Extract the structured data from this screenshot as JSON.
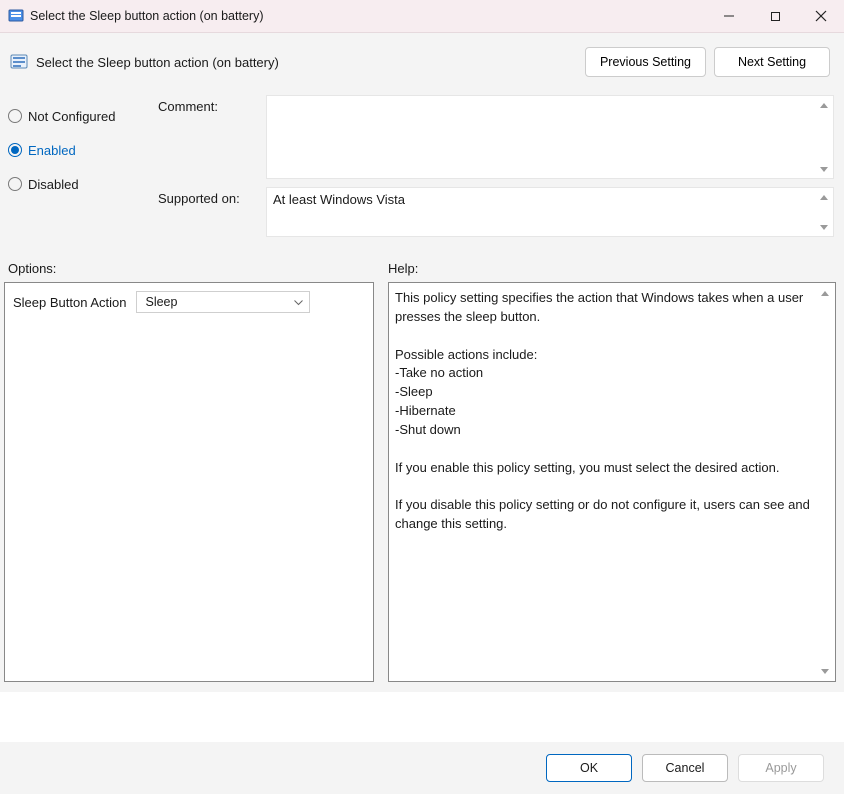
{
  "window": {
    "title": "Select the Sleep button action (on battery)"
  },
  "header": {
    "title": "Select the Sleep button action (on battery)",
    "prev_btn": "Previous Setting",
    "next_btn": "Next Setting"
  },
  "state": {
    "not_configured": "Not Configured",
    "enabled": "Enabled",
    "disabled": "Disabled",
    "selected": "enabled"
  },
  "fields": {
    "comment_label": "Comment:",
    "comment_value": "",
    "supported_label": "Supported on:",
    "supported_value": "At least Windows Vista"
  },
  "sections": {
    "options": "Options:",
    "help": "Help:"
  },
  "option": {
    "label": "Sleep Button Action",
    "value": "Sleep"
  },
  "help_text": "This policy setting specifies the action that Windows takes when a user presses the sleep button.\n\nPossible actions include:\n-Take no action\n-Sleep\n-Hibernate\n-Shut down\n\nIf you enable this policy setting, you must select the desired action.\n\nIf you disable this policy setting or do not configure it, users can see and change this setting.",
  "footer": {
    "ok": "OK",
    "cancel": "Cancel",
    "apply": "Apply"
  }
}
